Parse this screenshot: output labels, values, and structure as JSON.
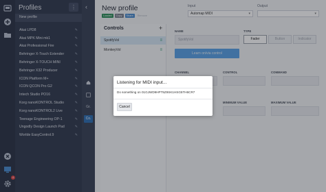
{
  "profiles": {
    "title": "Profiles",
    "menu_label": "⋮",
    "items": [
      {
        "label": "New profile",
        "selected": true
      },
      {
        "label": "Akai LPD8"
      },
      {
        "label": "Akai MPK Mini mk1"
      },
      {
        "label": "Akai Professional Fire"
      },
      {
        "label": "Behringer X-Touch Extender"
      },
      {
        "label": "Behringer X-TOUCH MINI"
      },
      {
        "label": "Behringer X32 Producer"
      },
      {
        "label": "ICON Platform M+"
      },
      {
        "label": "ICON QCON Pro G2"
      },
      {
        "label": "Intech Studio PO16"
      },
      {
        "label": "Korg nanoKONTROL Studio"
      },
      {
        "label": "Korg nanoKONTROL2 Live"
      },
      {
        "label": "Teenage Engineering OP-1"
      },
      {
        "label": "Ungodly Design Launch Pad"
      },
      {
        "label": "Worlde EasyControl.9"
      }
    ]
  },
  "rail": {
    "badge": "4"
  },
  "strip": {
    "back": "‹",
    "items": [
      "Gr.",
      "Co."
    ]
  },
  "header": {
    "title": "New profile",
    "tags": {
      "loaded": "Loaded",
      "copy": "Copy",
      "share": "Share",
      "remove": "Remove"
    },
    "input_label": "Input",
    "input_value": "Automap MIDI",
    "output_label": "Output",
    "output_value": ""
  },
  "controls": {
    "heading": "Controls",
    "add_label": "+",
    "items": [
      {
        "label": "SpotifyVol",
        "selected": true
      },
      {
        "label": "MonkeyVol",
        "selected": false
      }
    ]
  },
  "detail": {
    "name_label": "NAME",
    "name_value": "SpotifyVol",
    "type_label": "TYPE",
    "type_options": [
      "Fader",
      "Button",
      "Indicator"
    ],
    "type_selected": "Fader",
    "learn_label": "Learn on/via control",
    "channel_label": "CHANNEL",
    "control_label": "CONTROL",
    "command_label": "COMMAND",
    "min_label": "MINIMUM VALUE",
    "max_label": "MAXIMUM VALUE"
  },
  "modal": {
    "title": "Listening for MIDI input...",
    "message": "Do something on 01GJWD9HPT5Z9SK1HSG5TH6CR7",
    "cancel_label": "Cancel"
  },
  "colors": {
    "rail": "#2c3446",
    "profiles_bg": "#323b4f",
    "accent_blue": "#5aa2e6",
    "loaded_green": "#2f8f5b",
    "share_blue": "#4a8dd0"
  }
}
